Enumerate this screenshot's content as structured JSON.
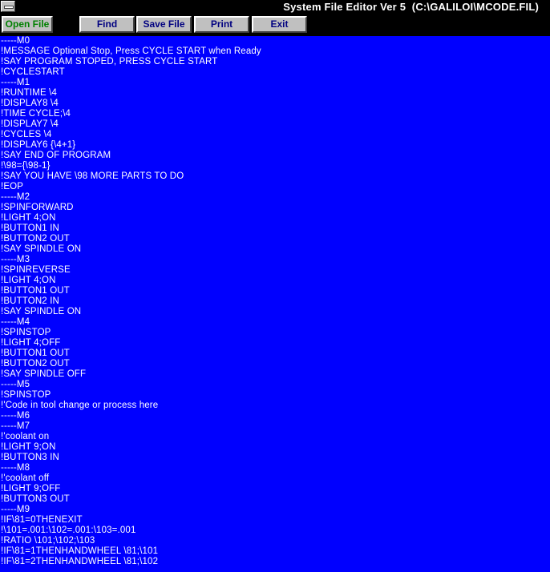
{
  "window": {
    "title": "System File Editor Ver 5  (C:\\GALILOI\\MCODE.FIL)"
  },
  "toolbar": {
    "buttons": [
      {
        "label": "Open File"
      },
      {
        "label": "Find"
      },
      {
        "label": "Save File"
      },
      {
        "label": "Print"
      },
      {
        "label": "Exit"
      }
    ]
  },
  "colors": {
    "editor_background": "#0000ff",
    "editor_text": "#ffffff",
    "button_face": "#c0c0c0",
    "button_text": "#000080",
    "active_button_text": "#008000"
  },
  "editor": {
    "lines": [
      "-----M0",
      "!MESSAGE Optional Stop, Press CYCLE START when Ready",
      "!SAY PROGRAM STOPED, PRESS CYCLE START",
      "!CYCLESTART",
      "-----M1",
      "!RUNTIME \\4",
      "!DISPLAY8 \\4",
      "!TIME CYCLE;\\4",
      "!DISPLAY7 \\4",
      "!CYCLES \\4",
      "!DISPLAY6 {\\4+1}",
      "!SAY END OF PROGRAM",
      "!\\98={\\98-1}",
      "!SAY YOU HAVE \\98 MORE PARTS TO DO",
      "!EOP",
      "-----M2",
      "!SPINFORWARD",
      "!LIGHT 4;ON",
      "!BUTTON1 IN",
      "!BUTTON2 OUT",
      "!SAY SPINDLE ON",
      "-----M3",
      "!SPINREVERSE",
      "!LIGHT 4;ON",
      "!BUTTON1 OUT",
      "!BUTTON2 IN",
      "!SAY SPINDLE ON",
      "-----M4",
      "!SPINSTOP",
      "!LIGHT 4;OFF",
      "!BUTTON1 OUT",
      "!BUTTON2 OUT",
      "!SAY SPINDLE OFF",
      "-----M5",
      "!SPINSTOP",
      "!'Code in tool change or process here",
      "-----M6",
      "-----M7",
      "!'coolant on",
      "!LIGHT 9;ON",
      "!BUTTON3 IN",
      "-----M8",
      "!'coolant off",
      "!LIGHT 9;OFF",
      "!BUTTON3 OUT",
      "-----M9",
      "!IF\\81=0THENEXIT",
      "!\\101=.001:\\102=.001:\\103=.001",
      "!RATIO \\101;\\102;\\103",
      "!IF\\81=1THENHANDWHEEL \\81;\\101",
      "!IF\\81=2THENHANDWHEEL \\81;\\102"
    ]
  }
}
